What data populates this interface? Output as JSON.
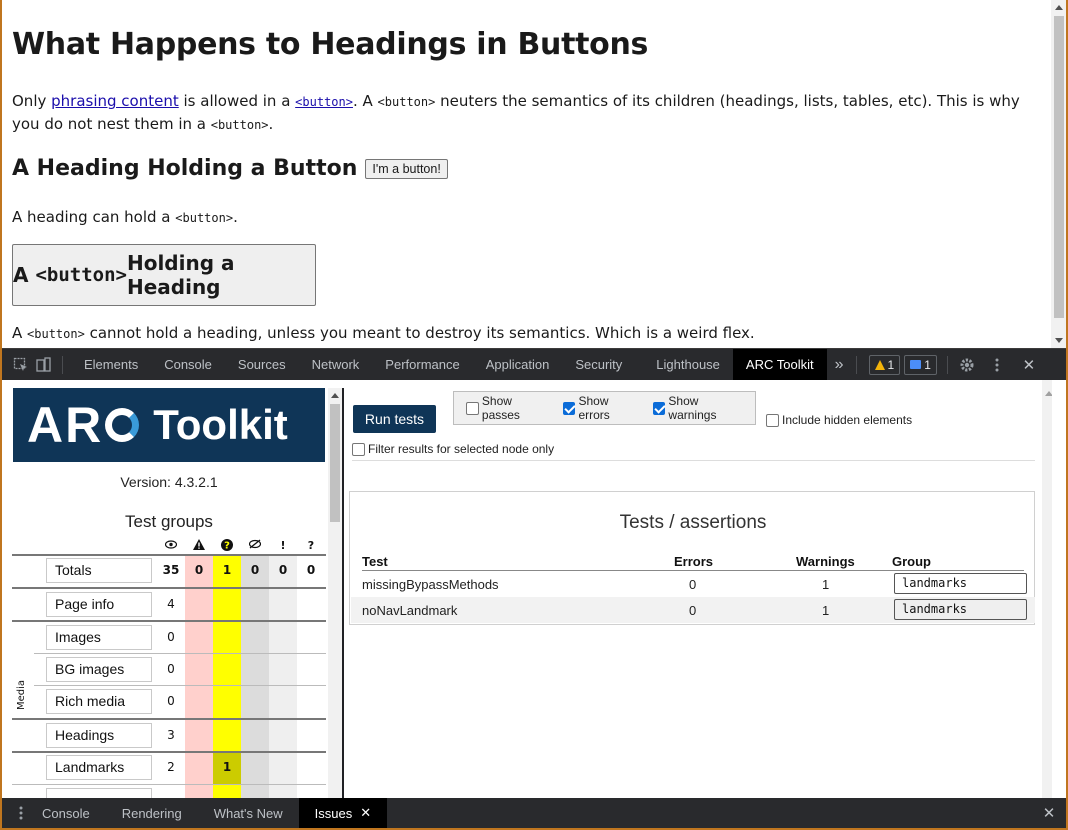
{
  "page": {
    "title": "What Happens to Headings in Buttons",
    "p1": {
      "t1": "Only ",
      "link1": "phrasing content",
      "t2": " is allowed in a ",
      "link2": "<button>",
      "t3": ". A ",
      "code1": "<button>",
      "t4": " neuters the semantics of its children (headings, lists, tables, etc). This is why you do not nest them in a ",
      "code2": "<button>",
      "t5": "."
    },
    "h2": "A Heading Holding a Button",
    "small_button": "I'm a button!",
    "p2": {
      "t1": "A heading can hold a ",
      "code": "<button>",
      "t2": "."
    },
    "big_button": {
      "t1": "A ",
      "code": "<button>",
      "t2": " Holding a Heading"
    },
    "p3": {
      "t1": "A ",
      "code": "<button>",
      "t2": " cannot hold a heading, unless you meant to destroy its semantics. Which is a weird flex."
    }
  },
  "devtools": {
    "tabs": [
      "Elements",
      "Console",
      "Sources",
      "Network",
      "Performance",
      "Application",
      "Security",
      "Lighthouse",
      "ARC Toolkit"
    ],
    "active_tab": "ARC Toolkit",
    "more": "»",
    "warnings_count": "1",
    "issues_count": "1",
    "drawer_tabs": [
      "Console",
      "Rendering",
      "What's New",
      "Issues"
    ],
    "drawer_active": "Issues",
    "close": "✕"
  },
  "arc": {
    "logo_text_1": "AR",
    "logo_text_2": "Toolkit",
    "version": "Version: 4.3.2.1",
    "test_groups": "Test groups",
    "col_headers": [
      "👁",
      "⚠",
      "?",
      "👁",
      "!",
      "?"
    ],
    "rows": [
      {
        "label": "Totals",
        "values": [
          "35",
          "0",
          "1",
          "0",
          "0",
          "0"
        ]
      },
      {
        "label": "Page info",
        "values": [
          "4",
          "",
          "",
          "",
          "",
          ""
        ]
      },
      {
        "label": "Images",
        "values": [
          "0",
          "",
          "",
          "",
          "",
          ""
        ]
      },
      {
        "label": "BG images",
        "values": [
          "0",
          "",
          "",
          "",
          "",
          ""
        ]
      },
      {
        "label": "Rich media",
        "values": [
          "0",
          "",
          "",
          "",
          "",
          ""
        ]
      },
      {
        "label": "Headings",
        "values": [
          "3",
          "",
          "",
          "",
          "",
          ""
        ]
      },
      {
        "label": "Landmarks",
        "values": [
          "2",
          "",
          "1",
          "",
          "",
          ""
        ]
      }
    ],
    "media_label": "Media",
    "run_tests": "Run tests",
    "options": {
      "show_passes": {
        "label": "Show passes",
        "checked": false
      },
      "show_errors": {
        "label": "Show errors",
        "checked": true
      },
      "show_warnings": {
        "label": "Show warnings",
        "checked": true
      },
      "include_hidden": {
        "label": "Include hidden elements",
        "checked": false
      },
      "filter_selected": {
        "label": "Filter results for selected node only",
        "checked": false
      }
    },
    "results_title": "Tests / assertions",
    "table_headers": {
      "test": "Test",
      "errors": "Errors",
      "warnings": "Warnings",
      "group": "Group"
    },
    "results": [
      {
        "test": "missingBypassMethods",
        "errors": "0",
        "warnings": "1",
        "group": "landmarks"
      },
      {
        "test": "noNavLandmark",
        "errors": "0",
        "warnings": "1",
        "group": "landmarks"
      }
    ]
  },
  "colors": {
    "arc_navy": "#0f3557",
    "devtools_bg": "#292a2d",
    "warning_yellow": "#ffff00",
    "error_pink": "#ffd0cc"
  }
}
